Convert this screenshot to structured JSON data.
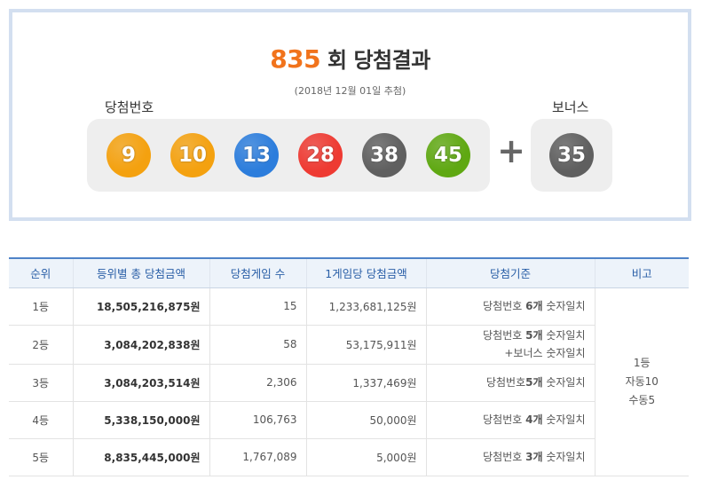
{
  "header": {
    "round": "835",
    "title_suffix": "회 당첨결과",
    "draw_date": "(2018년 12월 01일 추첨)"
  },
  "numbers": {
    "label": "당첨번호",
    "balls": [
      {
        "value": "9",
        "color": "#f4a10f"
      },
      {
        "value": "10",
        "color": "#f4a10f"
      },
      {
        "value": "13",
        "color": "#2c7ddc"
      },
      {
        "value": "28",
        "color": "#ee3a32"
      },
      {
        "value": "38",
        "color": "#5f5f5f"
      },
      {
        "value": "45",
        "color": "#5fa812"
      }
    ],
    "plus": "+",
    "bonus_label": "보너스",
    "bonus": {
      "value": "35",
      "color": "#5f5f5f"
    }
  },
  "table": {
    "headers": [
      "순위",
      "등위별 총 당첨금액",
      "당첨게임 수",
      "1게임당 당첨금액",
      "당첨기준",
      "비고"
    ],
    "rows": [
      {
        "rank": "1등",
        "total": "18,505,216,875원",
        "winners": "15",
        "per_game": "1,233,681,125원",
        "criteria_a": "당첨번호 ",
        "criteria_b": "6개",
        "criteria_c": " 숫자일치",
        "criteria_line2": ""
      },
      {
        "rank": "2등",
        "total": "3,084,202,838원",
        "winners": "58",
        "per_game": "53,175,911원",
        "criteria_a": "당첨번호 ",
        "criteria_b": "5개",
        "criteria_c": " 숫자일치",
        "criteria_line2": "+보너스 숫자일치"
      },
      {
        "rank": "3등",
        "total": "3,084,203,514원",
        "winners": "2,306",
        "per_game": "1,337,469원",
        "criteria_a": "당첨번호",
        "criteria_b": "5개",
        "criteria_c": " 숫자일치",
        "criteria_line2": ""
      },
      {
        "rank": "4등",
        "total": "5,338,150,000원",
        "winners": "106,763",
        "per_game": "50,000원",
        "criteria_a": "당첨번호 ",
        "criteria_b": "4개",
        "criteria_c": " 숫자일치",
        "criteria_line2": ""
      },
      {
        "rank": "5등",
        "total": "8,835,445,000원",
        "winners": "1,767,089",
        "per_game": "5,000원",
        "criteria_a": "당첨번호 ",
        "criteria_b": "3개",
        "criteria_c": " 숫자일치",
        "criteria_line2": ""
      }
    ],
    "note": [
      "1등",
      "자동10",
      "수동5"
    ]
  }
}
